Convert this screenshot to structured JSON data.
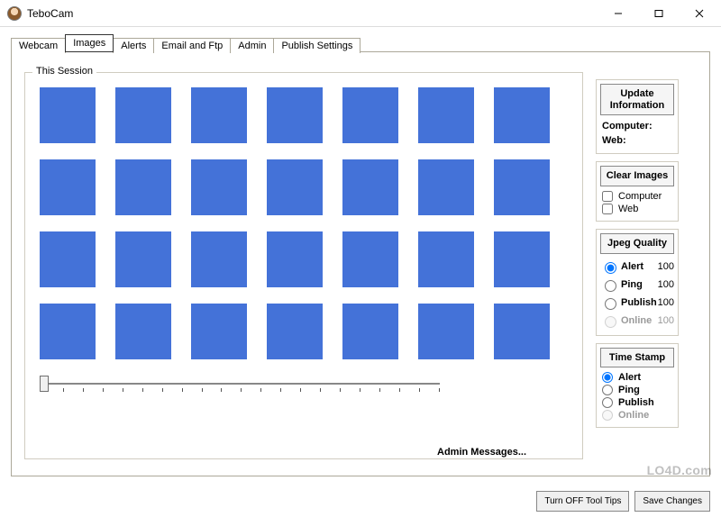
{
  "window": {
    "title": "TeboCam",
    "controls": {
      "min": "minimize",
      "max": "maximize",
      "close": "close"
    }
  },
  "tabs": [
    "Webcam",
    "Images",
    "Alerts",
    "Email and Ftp",
    "Admin",
    "Publish Settings"
  ],
  "active_tab": "Images",
  "session": {
    "legend": "This Session",
    "thumb_count": 28,
    "thumb_color": "#4472d8",
    "admin_messages_label": "Admin Messages..."
  },
  "side": {
    "update_info": {
      "button": "Update Information",
      "computer_label": "Computer:",
      "web_label": "Web:"
    },
    "clear_images": {
      "button": "Clear Images",
      "computer": {
        "label": "Computer",
        "checked": false
      },
      "web": {
        "label": "Web",
        "checked": false
      }
    },
    "jpeg_quality": {
      "legend": "Jpeg Quality",
      "rows": [
        {
          "label": "Alert",
          "value": "100",
          "selected": true,
          "enabled": true
        },
        {
          "label": "Ping",
          "value": "100",
          "selected": false,
          "enabled": true
        },
        {
          "label": "Publish",
          "value": "100",
          "selected": false,
          "enabled": true
        },
        {
          "label": "Online",
          "value": "100",
          "selected": false,
          "enabled": false
        }
      ]
    },
    "time_stamp": {
      "legend": "Time Stamp",
      "rows": [
        {
          "label": "Alert",
          "selected": true,
          "enabled": true
        },
        {
          "label": "Ping",
          "selected": false,
          "enabled": true
        },
        {
          "label": "Publish",
          "selected": false,
          "enabled": true
        },
        {
          "label": "Online",
          "selected": false,
          "enabled": false
        }
      ]
    }
  },
  "bottom": {
    "tool_tips": "Turn OFF Tool Tips",
    "save_changes": "Save Changes"
  },
  "watermark": "LO4D.com"
}
